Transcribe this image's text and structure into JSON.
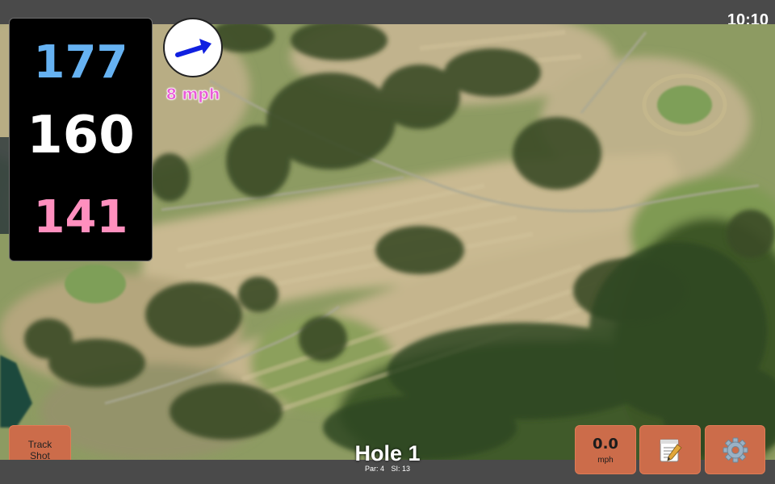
{
  "status_bar": {
    "clock": "10:10"
  },
  "yardage": {
    "back": "177",
    "middle": "160",
    "front": "141"
  },
  "wind": {
    "speed_label": "8 mph",
    "direction_icon": "wind-arrow-icon"
  },
  "buttons": {
    "track_shot_line1": "Track",
    "track_shot_line2": "Shot",
    "speed_value": "0.0",
    "speed_unit": "mph",
    "notes_icon": "notepad-icon",
    "settings_icon": "gear-icon"
  },
  "hole": {
    "title": "Hole 1",
    "par_label": "Par: 4",
    "si_label": "SI: 13"
  },
  "colors": {
    "back_yardage": "#66b2f2",
    "middle_yardage": "#ffffff",
    "front_yardage": "#ff8fbe",
    "button": "#cc6c4a",
    "wind_arrow": "#1020e0",
    "wind_label": "#e95bd8"
  }
}
